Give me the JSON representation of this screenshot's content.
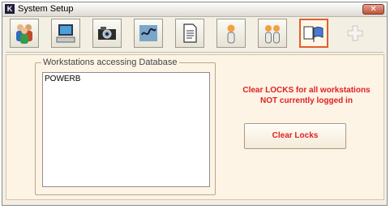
{
  "window": {
    "title": "System Setup",
    "app_icon_letter": "K",
    "close_glyph": "✕"
  },
  "toolbar": {
    "buttons": [
      {
        "icon": "users-group-icon"
      },
      {
        "icon": "computer-icon"
      },
      {
        "icon": "camera-icon"
      },
      {
        "icon": "signature-icon"
      },
      {
        "icon": "document-icon"
      },
      {
        "icon": "person-icon"
      },
      {
        "icon": "two-people-icon"
      },
      {
        "icon": "flags-icon",
        "active": true
      },
      {
        "icon": "add-icon",
        "disabled": true
      }
    ]
  },
  "workstations": {
    "group_title": "Workstations accessing Database",
    "items": [
      "POWERB"
    ]
  },
  "locks": {
    "message_line1": "Clear LOCKS for all workstations",
    "message_line2": "NOT currently logged in",
    "clear_button_label": "Clear Locks"
  },
  "colors": {
    "accent_red": "#e02020",
    "panel_bg": "#fdf4e6",
    "active_border": "#e06030"
  }
}
